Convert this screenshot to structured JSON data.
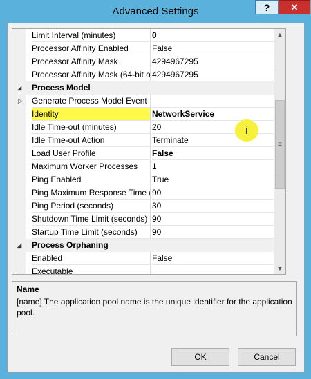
{
  "window": {
    "title": "Advanced Settings",
    "help_label": "?",
    "close_label": "✕"
  },
  "property_grid": {
    "rows": [
      {
        "type": "prop",
        "name": "Limit Interval (minutes)",
        "value": "0",
        "value_bold": true
      },
      {
        "type": "prop",
        "name": "Processor Affinity Enabled",
        "value": "False"
      },
      {
        "type": "prop",
        "name": "Processor Affinity Mask",
        "value": "4294967295"
      },
      {
        "type": "prop",
        "name": "Processor Affinity Mask (64-bit o",
        "value": "4294967295"
      },
      {
        "type": "category",
        "name": "Process Model",
        "expanded": true
      },
      {
        "type": "prop",
        "name": "Generate Process Model Event L",
        "value": "",
        "expandable": true
      },
      {
        "type": "prop",
        "name": "Identity",
        "value": "NetworkService",
        "value_bold": true,
        "highlighted": true
      },
      {
        "type": "prop",
        "name": "Idle Time-out (minutes)",
        "value": "20"
      },
      {
        "type": "prop",
        "name": "Idle Time-out Action",
        "value": "Terminate"
      },
      {
        "type": "prop",
        "name": "Load User Profile",
        "value": "False",
        "value_bold": true
      },
      {
        "type": "prop",
        "name": "Maximum Worker Processes",
        "value": "1"
      },
      {
        "type": "prop",
        "name": "Ping Enabled",
        "value": "True"
      },
      {
        "type": "prop",
        "name": "Ping Maximum Response Time (",
        "value": "90"
      },
      {
        "type": "prop",
        "name": "Ping Period (seconds)",
        "value": "30"
      },
      {
        "type": "prop",
        "name": "Shutdown Time Limit (seconds)",
        "value": "90"
      },
      {
        "type": "prop",
        "name": "Startup Time Limit (seconds)",
        "value": "90"
      },
      {
        "type": "category",
        "name": "Process Orphaning",
        "expanded": true
      },
      {
        "type": "prop",
        "name": "Enabled",
        "value": "False"
      },
      {
        "type": "prop",
        "name": "Executable",
        "value": ""
      }
    ]
  },
  "info_bubble": {
    "label": "i"
  },
  "description": {
    "title": "Name",
    "text": "[name] The application pool name is the unique identifier for the application pool."
  },
  "buttons": {
    "ok_label": "OK",
    "cancel_label": "Cancel"
  },
  "icons": {
    "category_expanded": "triangle-down-icon",
    "row_expand": "triangle-right-icon",
    "scroll_up": "arrow-up-icon",
    "scroll_down": "arrow-down-icon",
    "scroll_grip": "grip-icon"
  },
  "colors": {
    "highlight": "#fff94a",
    "info_bubble": "#f7f13e",
    "title_bar": "#5ab1dc",
    "close_button": "#c7302d"
  }
}
